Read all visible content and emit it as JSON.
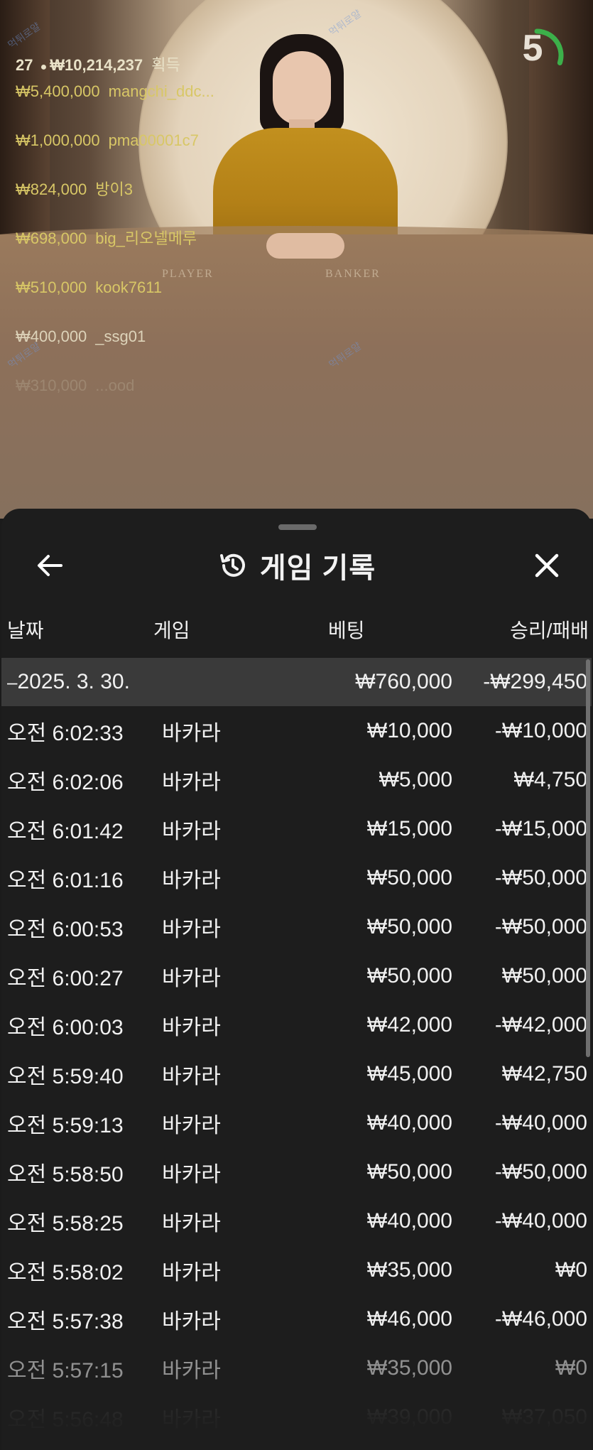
{
  "video": {
    "table_labels": {
      "player": "PLAYER",
      "banker": "BANKER"
    },
    "timer": {
      "value": "5",
      "fraction": 0.3,
      "accent": "#3cb04a"
    },
    "watermark": "먹튀로얄"
  },
  "bet_overlay": {
    "player_count": "27",
    "total": "₩10,214,237",
    "total_suffix": "획득",
    "rows": [
      {
        "amount": "₩5,400,000",
        "name": "mangchi_ddc..."
      },
      {
        "amount": "₩1,000,000",
        "name": "pma00001c7"
      },
      {
        "amount": "₩824,000",
        "name": "방이3"
      },
      {
        "amount": "₩698,000",
        "name": "big_리오넬메루"
      },
      {
        "amount": "₩510,000",
        "name": "kook7611"
      },
      {
        "amount": "₩400,000",
        "name": "_ssg01"
      },
      {
        "amount": "₩310,000",
        "name": "...ood"
      }
    ]
  },
  "sheet": {
    "title": "게임 기록",
    "icons": {
      "back": "arrow-left-icon",
      "history": "history-icon",
      "close": "close-icon"
    },
    "columns": {
      "date": "날짜",
      "game": "게임",
      "bet": "베팅",
      "result": "승리/패배"
    },
    "date_group": {
      "date": "2025. 3. 30.",
      "bet": "₩760,000",
      "result": "-₩299,450"
    },
    "rows": [
      {
        "time": "오전 6:02:33",
        "game": "바카라",
        "bet": "₩10,000",
        "result": "-₩10,000"
      },
      {
        "time": "오전 6:02:06",
        "game": "바카라",
        "bet": "₩5,000",
        "result": "₩4,750"
      },
      {
        "time": "오전 6:01:42",
        "game": "바카라",
        "bet": "₩15,000",
        "result": "-₩15,000"
      },
      {
        "time": "오전 6:01:16",
        "game": "바카라",
        "bet": "₩50,000",
        "result": "-₩50,000"
      },
      {
        "time": "오전 6:00:53",
        "game": "바카라",
        "bet": "₩50,000",
        "result": "-₩50,000"
      },
      {
        "time": "오전 6:00:27",
        "game": "바카라",
        "bet": "₩50,000",
        "result": "₩50,000"
      },
      {
        "time": "오전 6:00:03",
        "game": "바카라",
        "bet": "₩42,000",
        "result": "-₩42,000"
      },
      {
        "time": "오전 5:59:40",
        "game": "바카라",
        "bet": "₩45,000",
        "result": "₩42,750"
      },
      {
        "time": "오전 5:59:13",
        "game": "바카라",
        "bet": "₩40,000",
        "result": "-₩40,000"
      },
      {
        "time": "오전 5:58:50",
        "game": "바카라",
        "bet": "₩50,000",
        "result": "-₩50,000"
      },
      {
        "time": "오전 5:58:25",
        "game": "바카라",
        "bet": "₩40,000",
        "result": "-₩40,000"
      },
      {
        "time": "오전 5:58:02",
        "game": "바카라",
        "bet": "₩35,000",
        "result": "₩0"
      },
      {
        "time": "오전 5:57:38",
        "game": "바카라",
        "bet": "₩46,000",
        "result": "-₩46,000"
      },
      {
        "time": "오전 5:57:15",
        "game": "바카라",
        "bet": "₩35,000",
        "result": "₩0"
      },
      {
        "time": "오전 5:56:48",
        "game": "바카라",
        "bet": "₩39,000",
        "result": "₩37,050"
      }
    ]
  }
}
